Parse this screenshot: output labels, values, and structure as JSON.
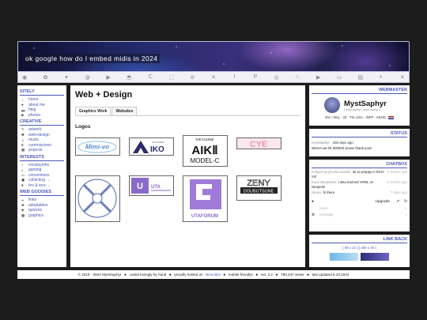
{
  "banner": {
    "title": "ok google how do I embed midis in 2024"
  },
  "iconbar": [
    "reddit-icon",
    "butterfly-icon",
    "butterfly-icon",
    "mastodon-icon",
    "twitch-icon",
    "kofi-icon",
    "c-icon",
    "crop-icon",
    "circle-slash-icon",
    "x-icon",
    "tumblr-icon",
    "p-icon",
    "github-icon",
    "home-icon",
    "youtube-icon",
    "tv-icon",
    "card-icon",
    "d-icon",
    "x-close-icon"
  ],
  "sidebar": {
    "sections": [
      {
        "title": "SITELY",
        "items": [
          {
            "icon": "home-icon",
            "glyph": "⌂",
            "label": "home"
          },
          {
            "icon": "user-icon",
            "glyph": "●",
            "label": "about me"
          },
          {
            "icon": "book-icon",
            "glyph": "▬",
            "label": "blog"
          },
          {
            "icon": "camera-icon",
            "glyph": "◙",
            "label": "photos"
          }
        ]
      },
      {
        "title": "CREATIVE",
        "items": [
          {
            "icon": "pencil-icon",
            "glyph": "✎",
            "label": "artwork"
          },
          {
            "icon": "gear-icon",
            "glyph": "✱",
            "label": "web+design"
          },
          {
            "icon": "music-icon",
            "glyph": "♫",
            "label": "music"
          },
          {
            "icon": "dollar-icon",
            "glyph": "$",
            "label": "commissions"
          },
          {
            "icon": "grid-icon",
            "glyph": "▦",
            "label": "projects"
          }
        ]
      },
      {
        "title": "INTERESTS",
        "items": [
          {
            "icon": "microphone-icon",
            "glyph": "♪",
            "label": "vocalsynths"
          },
          {
            "icon": "gamepad-icon",
            "glyph": "◐",
            "label": "gaming"
          },
          {
            "icon": "ticket-icon",
            "glyph": "▭",
            "label": "conventions"
          },
          {
            "icon": "bag-icon",
            "glyph": "▣",
            "label": "collecting →"
          },
          {
            "icon": "heart-icon",
            "glyph": "♥",
            "label": "kro & tora →"
          }
        ]
      },
      {
        "title": "WEB GOODIES",
        "items": [
          {
            "icon": "link-icon",
            "glyph": "∞",
            "label": "links"
          },
          {
            "icon": "paw-icon",
            "glyph": "❀",
            "label": "adoptables"
          },
          {
            "icon": "quiz-icon",
            "glyph": "◈",
            "label": "quizzes"
          },
          {
            "icon": "image-icon",
            "glyph": "▩",
            "label": "graphics"
          }
        ]
      }
    ]
  },
  "main": {
    "title": "Web + Design",
    "tabs": [
      "Graphics Work",
      "Websites"
    ],
    "section_title": "Logos",
    "logos": [
      {
        "name": "logo-mimi-vo",
        "text": "Mimi-vo",
        "color": "#5a8ed0"
      },
      {
        "name": "logo-kikyuune-aiko",
        "text": "KIKYUUNE AIKO",
        "color": "#2c2c6a"
      },
      {
        "name": "logo-kikyuune-aiko-model-c",
        "text": "KIKYUUNE AIKII MODEL-C",
        "color": "#111111"
      },
      {
        "name": "logo-cye",
        "text": "CYE",
        "color": "#e59ab0"
      },
      {
        "name": "logo-circle-emblem",
        "text": "",
        "color": "#6a7ec0"
      },
      {
        "name": "logo-uta-utaunion",
        "text": "UTA",
        "color": "#8a6acb"
      },
      {
        "name": "logo-uta-forum",
        "text": "UTAFORUM",
        "color": "#8a6acb"
      },
      {
        "name": "logo-zeny-doubutsune",
        "text": "ZENY DOUBUTSUNE",
        "color": "#222222"
      }
    ]
  },
  "webmaster": {
    "header": "WEBMASTER",
    "name": "MystSaphyr",
    "subtitle": "[ myst saphyr | myst saphyr ]",
    "meta": "she / they · 33 · TN, USA · INFP · ADHD"
  },
  "status": {
    "header": "STATUS",
    "user": "mystSaphyr",
    "time": "266 days ago",
    "text": "WHOA we hit 600000 views! thank you!!"
  },
  "chatbox": {
    "header": "CHATBOX",
    "messages": [
      {
        "user": "hedgehog-ghostie-wobble:",
        "text": "its so preppy in there /ref",
        "time": "2 months ago"
      },
      {
        "user": "beyondingletttos:",
        "text": "I also learned HTML on Neopets!",
        "time": "6 months ago"
      },
      {
        "user": "nikayo:",
        "text": "hi there",
        "time": "7 days ago"
      }
    ],
    "upgrade_label": "Upgrade",
    "name_placeholder": "name",
    "message_placeholder": "message"
  },
  "linkback": {
    "header": "LINK BACK",
    "sizes": "[ 88 x 31 ]   [ 200 x 40 ]"
  },
  "footer": {
    "text1": "© 2019 - 2024 MystSaphyr",
    "text2": "coded lovingly by hand",
    "text3": "proudly hosted on",
    "host": "Neocities",
    "text4": "mobile friendly!",
    "text5": "ver. 2.2",
    "text6": "780,247 views",
    "text7": "last updated 6.10.2024"
  }
}
